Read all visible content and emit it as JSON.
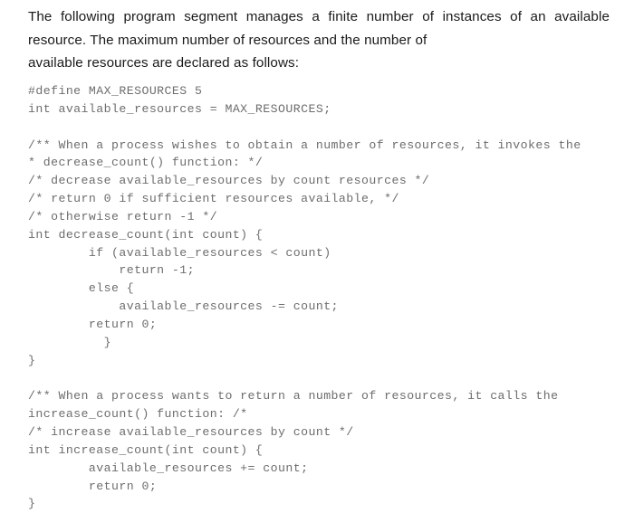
{
  "document": {
    "intro": {
      "line1": "The following program segment manages a finite number of instances of an",
      "line2": "available resource. The maximum number of resources and the number of",
      "line3": "available resources are declared as follows:"
    },
    "code": {
      "language": "c",
      "lines": [
        "#define MAX_RESOURCES 5",
        "int available_resources = MAX_RESOURCES;",
        "",
        "/** When a process wishes to obtain a number of resources, it invokes the",
        "* decrease_count() function: */",
        "/* decrease available_resources by count resources */",
        "/* return 0 if sufficient resources available, */",
        "/* otherwise return -1 */",
        "int decrease_count(int count) {",
        "        if (available_resources < count)",
        "            return -1;",
        "        else {",
        "            available_resources -= count;",
        "        return 0;",
        "          }",
        "}",
        "",
        "/** When a process wants to return a number of resources, it calls the",
        "increase_count() function: /*",
        "/* increase available_resources by count */",
        "int increase_count(int count) {",
        "        available_resources += count;",
        "        return 0;",
        "}"
      ]
    }
  },
  "colors": {
    "background": "#ffffff",
    "paragraph_text": "#1a1a1a",
    "code_text": "#6d6d6d"
  }
}
